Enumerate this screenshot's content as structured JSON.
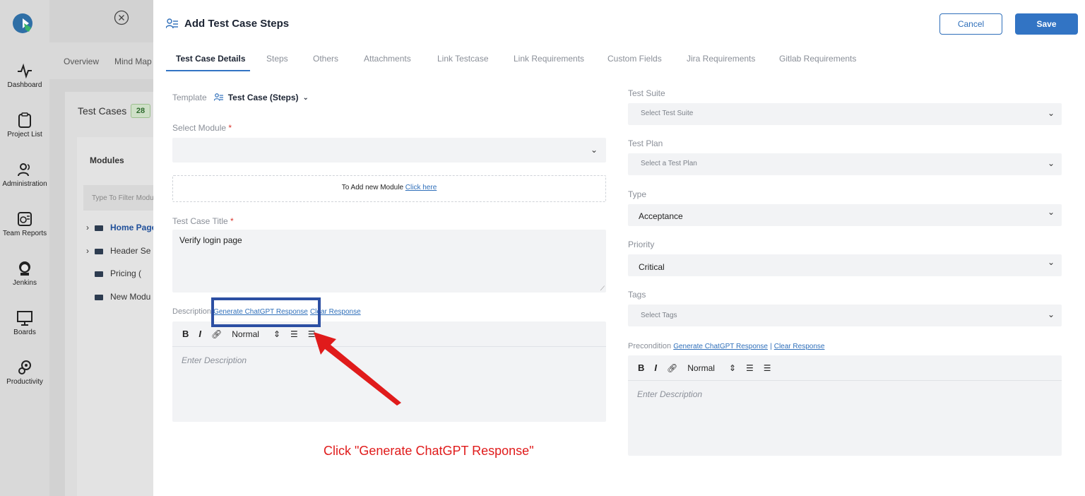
{
  "sidenav": {
    "items": [
      {
        "label": "Dashboard",
        "icon": "activity-icon"
      },
      {
        "label": "Project List",
        "icon": "clipboard-icon"
      },
      {
        "label": "Administration",
        "icon": "users-icon"
      },
      {
        "label": "Team Reports",
        "icon": "report-icon"
      },
      {
        "label": "Jenkins",
        "icon": "jenkins-icon"
      },
      {
        "label": "Boards",
        "icon": "board-icon"
      },
      {
        "label": "Productivity",
        "icon": "gears-icon"
      }
    ]
  },
  "background": {
    "tabs": [
      "Overview",
      "Mind Map"
    ],
    "title": "Test Cases",
    "count": "28",
    "modules_heading": "Modules",
    "filter_placeholder": "Type To Filter Modules",
    "modules": [
      {
        "label": "Home Page",
        "expandable": true
      },
      {
        "label": "Header Se",
        "expandable": true
      },
      {
        "label": "Pricing (",
        "expandable": false
      },
      {
        "label": "New Modu",
        "expandable": false
      }
    ]
  },
  "modal": {
    "title": "Add Test Case Steps",
    "cancel_label": "Cancel",
    "save_label": "Save",
    "tabs": [
      "Test Case Details",
      "Steps",
      "Others",
      "Attachments",
      "Link Testcase",
      "Link Requirements",
      "Custom Fields",
      "Jira Requirements",
      "Gitlab Requirements"
    ],
    "active_tab": "Test Case Details",
    "template_label": "Template",
    "template_value": "Test Case (Steps)",
    "module_label": "Select Module",
    "add_module_text": "To Add new Module",
    "add_module_link": "Click here",
    "title_label": "Test Case Title",
    "title_value": "Verify login page",
    "description_label": "Description",
    "generate_link": "Generate ChatGPT Response",
    "clear_link": "Clear Response",
    "editor_format": "Normal",
    "editor_placeholder": "Enter Description",
    "right": {
      "suite_label": "Test Suite",
      "suite_placeholder": "Select Test Suite",
      "plan_label": "Test Plan",
      "plan_placeholder": "Select a Test Plan",
      "type_label": "Type",
      "type_value": "Acceptance",
      "priority_label": "Priority",
      "priority_value": "Critical",
      "tags_label": "Tags",
      "tags_placeholder": "Select Tags",
      "precondition_label": "Precondition",
      "separator": "|",
      "editor_placeholder": "Enter Description"
    }
  },
  "annotation": {
    "text": "Click \"Generate ChatGPT Response\"",
    "color": "#e01b1b",
    "box_color": "#2c4fa3"
  }
}
